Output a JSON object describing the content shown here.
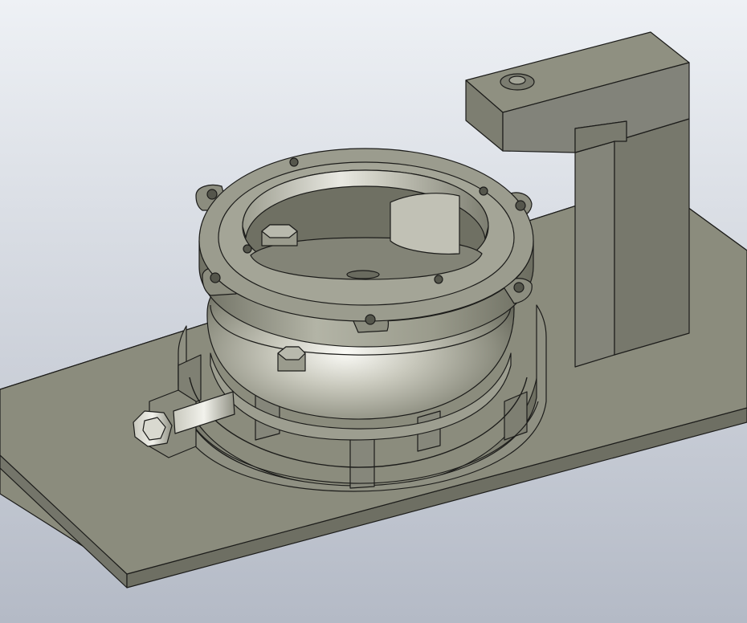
{
  "viewport": {
    "background_top": "#eef1f5",
    "background_bottom": "#b4bac6",
    "part_color": "#8a8b7c",
    "part_light": "#a9aa9b",
    "part_dark": "#6b6c5f",
    "edge_color": "#1c1c1a",
    "highlight": "#f4f4ef"
  },
  "parts": [
    {
      "name": "base-plate",
      "icon": "rectangular-plate"
    },
    {
      "name": "l-bracket",
      "icon": "l-shaped-arm"
    },
    {
      "name": "bracket-hole",
      "icon": "counterbored-hole"
    },
    {
      "name": "clamp-ring",
      "icon": "segmented-ring"
    },
    {
      "name": "dome-housing",
      "icon": "curved-shell"
    },
    {
      "name": "top-flange",
      "icon": "bolt-flange"
    },
    {
      "name": "hex-bolt",
      "icon": "hex-head-screw"
    }
  ]
}
